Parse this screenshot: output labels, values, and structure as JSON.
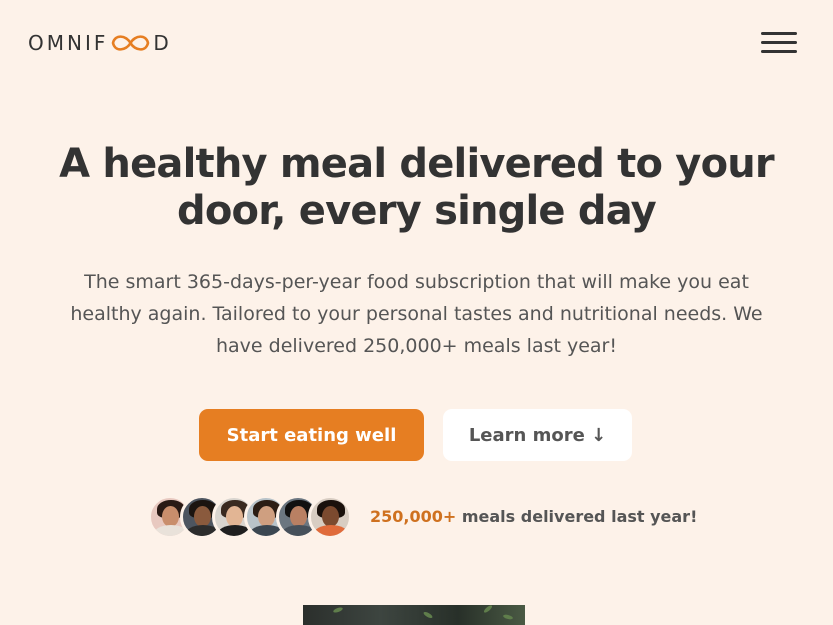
{
  "header": {
    "logo_prefix": "OMNIF",
    "logo_suffix": "D",
    "logo_icon": "infinity-icon",
    "menu_icon": "hamburger-menu-icon"
  },
  "hero": {
    "title": "A healthy meal delivered to your door, every single day",
    "description": "The smart 365-days-per-year food subscription that will make you eat healthy again. Tailored to your personal tastes and nutritional needs. We have delivered 250,000+ meals last year!",
    "primary_button": "Start eating well",
    "secondary_button": "Learn more ↓"
  },
  "customers": {
    "count": "250,000+",
    "text": "meals delivered last year!"
  },
  "colors": {
    "background": "#fdf2e9",
    "accent": "#e67e22",
    "accent_dark": "#cf711f",
    "text": "#333333"
  }
}
